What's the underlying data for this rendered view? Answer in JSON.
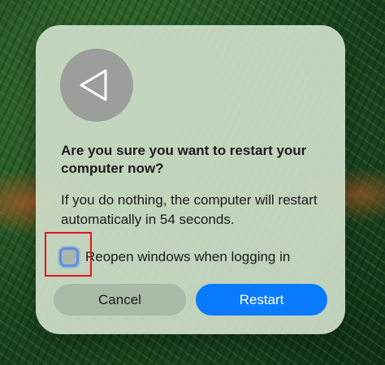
{
  "dialog": {
    "title": "Are you sure you want to restart your computer now?",
    "message": "If you do nothing, the computer will restart automatically in 54 seconds.",
    "checkbox": {
      "label": "Reopen windows when logging in",
      "checked": false
    },
    "cancel_label": "Cancel",
    "restart_label": "Restart",
    "icon": "restart-triangle-icon"
  },
  "colors": {
    "accent": "#0a7bff",
    "highlight": "#e2151d"
  }
}
